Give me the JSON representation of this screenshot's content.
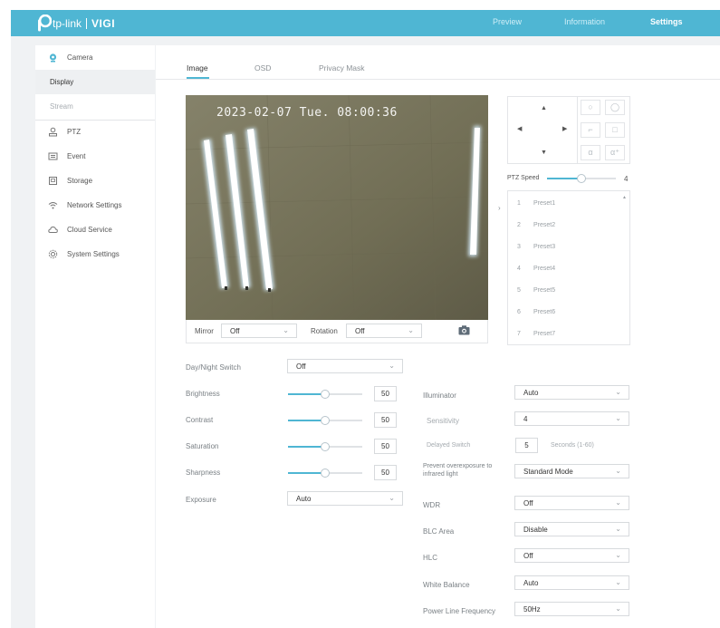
{
  "brand": {
    "logo_text": "tp-link",
    "product": "VIGI"
  },
  "nav": {
    "preview": "Preview",
    "information": "Information",
    "settings": "Settings"
  },
  "sidebar": {
    "camera": "Camera",
    "display": "Display",
    "stream": "Stream",
    "ptz": "PTZ",
    "event": "Event",
    "storage": "Storage",
    "network": "Network Settings",
    "cloud": "Cloud Service",
    "system": "System Settings"
  },
  "tabs": {
    "image": "Image",
    "osd": "OSD",
    "privacy": "Privacy Mask"
  },
  "video": {
    "osd_text": "2023-02-07 Tue. 08:00:36"
  },
  "video_bar": {
    "mirror_label": "Mirror",
    "mirror_value": "Off",
    "rotation_label": "Rotation",
    "rotation_value": "Off"
  },
  "ptz": {
    "speed_label": "PTZ Speed",
    "speed_value": "4",
    "speed_fraction": 0.5
  },
  "presets": [
    {
      "n": "1",
      "name": "Preset1"
    },
    {
      "n": "2",
      "name": "Preset2"
    },
    {
      "n": "3",
      "name": "Preset3"
    },
    {
      "n": "4",
      "name": "Preset4"
    },
    {
      "n": "5",
      "name": "Preset5"
    },
    {
      "n": "6",
      "name": "Preset6"
    },
    {
      "n": "7",
      "name": "Preset7"
    }
  ],
  "image": {
    "day_night_label": "Day/Night Switch",
    "day_night_value": "Off",
    "brightness_label": "Brightness",
    "brightness_value": "50",
    "contrast_label": "Contrast",
    "contrast_value": "50",
    "saturation_label": "Saturation",
    "saturation_value": "50",
    "sharpness_label": "Sharpness",
    "sharpness_value": "50",
    "exposure_label": "Exposure",
    "exposure_value": "Auto",
    "illuminator_label": "Illuminator",
    "illuminator_value": "Auto",
    "sensitivity_label": "Sensitivity",
    "sensitivity_value": "4",
    "delayed_label": "Delayed Switch",
    "delayed_value": "5",
    "delayed_unit": "Seconds (1-60)",
    "prevent_label_1": "Prevent overexposure to",
    "prevent_label_2": "infrared light",
    "prevent_value": "Standard Mode",
    "wdr_label": "WDR",
    "wdr_value": "Off",
    "blc_label": "BLC Area",
    "blc_value": "Disable",
    "hlc_label": "HLC",
    "hlc_value": "Off",
    "wb_label": "White Balance",
    "wb_value": "Auto",
    "plf_label": "Power Line Frequency",
    "plf_value": "50Hz"
  },
  "colors": {
    "accent": "#4fb6d3",
    "topbar": "#4fb6d3",
    "background": "#f0f2f4"
  }
}
